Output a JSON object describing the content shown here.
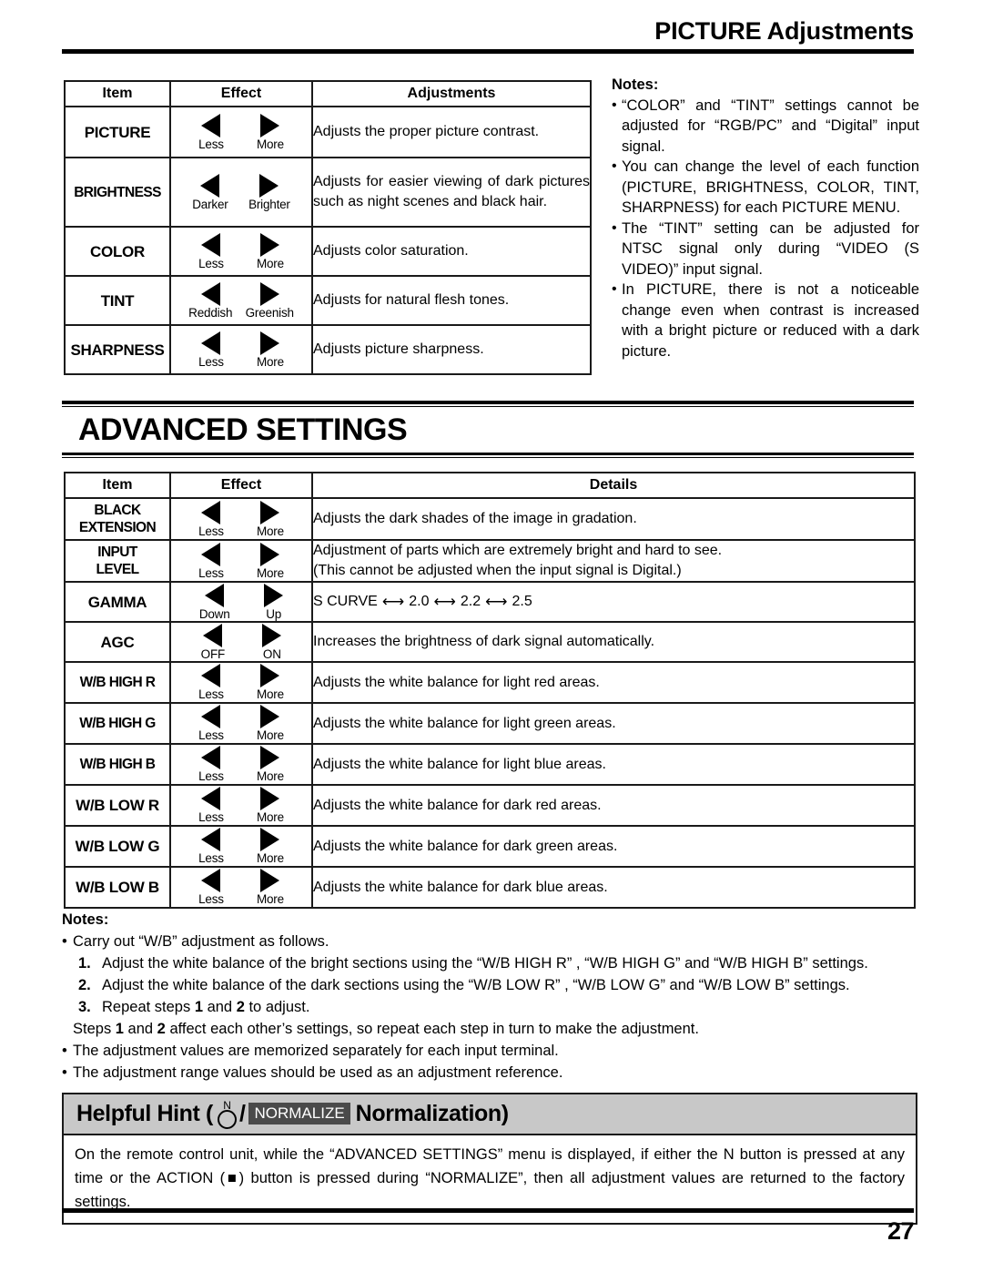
{
  "header": {
    "title": "PICTURE Adjustments"
  },
  "picture_table": {
    "columns": [
      "Item",
      "Effect",
      "Adjustments"
    ],
    "rows": [
      {
        "item": "PICTURE",
        "left_label": "Less",
        "right_label": "More",
        "desc": "Adjusts the proper picture contrast."
      },
      {
        "item": "BRIGHTNESS",
        "left_label": "Darker",
        "right_label": "Brighter",
        "desc": "Adjusts for easier viewing of dark pictures such as night scenes and black hair."
      },
      {
        "item": "COLOR",
        "left_label": "Less",
        "right_label": "More",
        "desc": "Adjusts color saturation."
      },
      {
        "item": "TINT",
        "left_label": "Reddish",
        "right_label": "Greenish",
        "desc": "Adjusts for natural flesh tones."
      },
      {
        "item": "SHARPNESS",
        "left_label": "Less",
        "right_label": "More",
        "desc": "Adjusts picture sharpness."
      }
    ]
  },
  "picture_notes": {
    "title": "Notes:",
    "bullet": "•",
    "items": [
      "“COLOR” and “TINT” settings cannot be adjusted for “RGB/PC” and “Digital” input signal.",
      "You can change the level of each function (PICTURE, BRIGHTNESS, COLOR, TINT, SHARPNESS) for each PICTURE MENU.",
      "The “TINT” setting can be adjusted for NTSC signal only during “VIDEO (S VIDEO)” input signal.",
      "In PICTURE, there is not a noticeable change even when contrast is increased with a bright picture or reduced with a dark picture."
    ]
  },
  "section": {
    "title": "ADVANCED SETTINGS"
  },
  "advanced_table": {
    "columns": [
      "Item",
      "Effect",
      "Details"
    ],
    "rows": [
      {
        "item": "BLACK EXTENSION",
        "item_line1": "BLACK",
        "item_line2": "EXTENSION",
        "left_label": "Less",
        "right_label": "More",
        "desc": "Adjusts the dark shades of the image in gradation."
      },
      {
        "item": "INPUT LEVEL",
        "item_line1": "INPUT",
        "item_line2": "LEVEL",
        "left_label": "Less",
        "right_label": "More",
        "desc": "Adjustment of parts which are extremely bright and hard to see.",
        "desc2": "(This cannot be adjusted when the input signal is Digital.)"
      },
      {
        "item": "GAMMA",
        "item_line1": "GAMMA",
        "item_line2": "",
        "left_label": "Down",
        "right_label": "Up",
        "gamma_sequence": [
          "S CURVE",
          "2.0",
          "2.2",
          "2.5"
        ],
        "arrow": "⟷"
      },
      {
        "item": "AGC",
        "item_line1": "AGC",
        "item_line2": "",
        "left_label": "OFF",
        "right_label": "ON",
        "desc": "Increases the brightness of dark signal automatically."
      },
      {
        "item": "W/B HIGH R",
        "item_line1": "W/B HIGH R",
        "item_line2": "",
        "left_label": "Less",
        "right_label": "More",
        "desc": "Adjusts the white balance for light red areas."
      },
      {
        "item": "W/B HIGH G",
        "item_line1": "W/B HIGH G",
        "item_line2": "",
        "left_label": "Less",
        "right_label": "More",
        "desc": "Adjusts the white balance for light green areas."
      },
      {
        "item": "W/B HIGH B",
        "item_line1": "W/B HIGH B",
        "item_line2": "",
        "left_label": "Less",
        "right_label": "More",
        "desc": "Adjusts the white balance for light blue areas."
      },
      {
        "item": "W/B LOW R",
        "item_line1": "W/B LOW R",
        "item_line2": "",
        "left_label": "Less",
        "right_label": "More",
        "desc": "Adjusts the white balance for dark red areas."
      },
      {
        "item": "W/B LOW G",
        "item_line1": "W/B LOW G",
        "item_line2": "",
        "left_label": "Less",
        "right_label": "More",
        "desc": "Adjusts the white balance for dark green areas."
      },
      {
        "item": "W/B LOW B",
        "item_line1": "W/B LOW B",
        "item_line2": "",
        "left_label": "Less",
        "right_label": "More",
        "desc": "Adjusts the white balance for dark blue areas."
      }
    ]
  },
  "advanced_notes": {
    "title": "Notes:",
    "bullet": "•",
    "lead": "Carry out “W/B” adjustment as follows.",
    "steps": [
      {
        "num": "1.",
        "text": "Adjust the white balance of the bright sections using the “W/B HIGH R” , “W/B HIGH G” and “W/B HIGH B” settings."
      },
      {
        "num": "2.",
        "text": "Adjust the white balance of the dark sections using the “W/B LOW R” , “W/B LOW G” and “W/B LOW B” settings."
      },
      {
        "num": "3.",
        "text": "Repeat steps 1 and 2 to adjust."
      }
    ],
    "closing": "Steps 1 and 2 affect each other’s settings, so repeat each step in turn to make the adjustment.",
    "tail_items": [
      "The adjustment values are memorized separately for each input terminal.",
      "The adjustment range values should be used as an adjustment reference."
    ]
  },
  "helpful_hint": {
    "prefix": "Helpful Hint (",
    "n_letter": "N",
    "slash": "/",
    "badge": "NORMALIZE",
    "suffix": "Normalization)",
    "body": "On the remote control unit, while the “ADVANCED SETTINGS” menu is displayed, if either the N button is pressed at any time or the ACTION (■) button is pressed during “NORMALIZE”, then all adjustment values are returned to the factory settings."
  },
  "footer": {
    "page_number": "27"
  },
  "colors": {
    "ink": "#000000",
    "rule": "#1a1a1a",
    "hint_header_bg": "#c8c8c8",
    "badge_bg": "#4a4a4a",
    "badge_fg": "#ffffff"
  }
}
